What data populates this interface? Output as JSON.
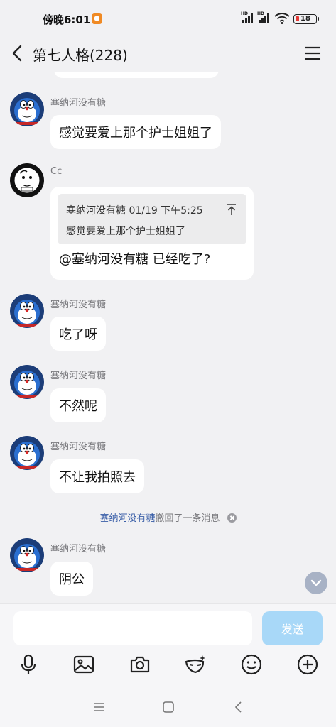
{
  "status_bar": {
    "time": "傍晚6:01",
    "battery": "18",
    "network_label": "HD"
  },
  "header": {
    "title": "第七人格(228)"
  },
  "messages": [
    {
      "sender": "塞纳河没有糖",
      "text": "感觉要爱上那个护士姐姐了"
    },
    {
      "sender": "Cc",
      "quote_meta": "塞纳河没有糖 01/19 下午5:25",
      "quote_text": "感觉要爱上那个护士姐姐了",
      "text": "@塞纳河没有糖 已经吃了?"
    },
    {
      "sender": "塞纳河没有糖",
      "text": "吃了呀"
    },
    {
      "sender": "塞纳河没有糖",
      "text": "不然呢"
    },
    {
      "sender": "塞纳河没有糖",
      "text": "不让我拍照去"
    },
    {
      "sender": "塞纳河没有糖",
      "text": "阴公"
    }
  ],
  "recall_notice": {
    "name": "塞纳河没有糖",
    "text": "撤回了一条消息"
  },
  "input_bar": {
    "placeholder": "",
    "send_label": "发送"
  },
  "toolbar_icons": [
    "microphone-icon",
    "image-icon",
    "camera-icon",
    "mask-icon",
    "emoji-icon",
    "plus-icon"
  ],
  "nav_icons": [
    "menu-icon",
    "home-icon",
    "back-icon"
  ],
  "colors": {
    "send_button": "#a8d8f8",
    "recall_name": "#3a5fa8",
    "background": "#f1f1f3"
  }
}
